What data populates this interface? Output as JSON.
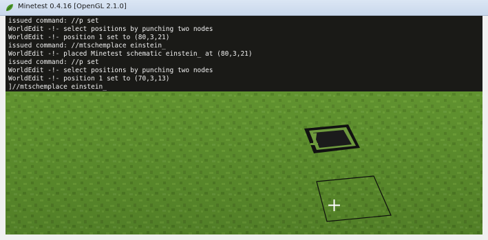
{
  "window": {
    "title": "Minetest 0.4.16 [OpenGL 2.1.0]"
  },
  "console": {
    "lines": [
      "issued command: //p set",
      "WorldEdit -!- select positions by punching two nodes",
      "WorldEdit -!- position 1 set to (80,3,21)",
      "issued command: //mtschemplace einstein_",
      "WorldEdit -!- placed Minetest schematic einstein_ at (80,3,21)",
      "issued command: //p set",
      "WorldEdit -!- select positions by punching two nodes",
      "WorldEdit -!- position 1 set to (70,3,13)",
      "]//mtschemplace einstein_"
    ]
  },
  "world": {
    "marker_glyph": "1",
    "colors": {
      "grass": "#5c8f2c",
      "grass_dark": "#4f7d24",
      "grass_light": "#6a9d35",
      "console_bg": "#1a1a17",
      "console_text": "#f0f0f0"
    }
  },
  "icons": {
    "app": "minetest-leaf-icon",
    "crosshair": "crosshair-icon"
  }
}
